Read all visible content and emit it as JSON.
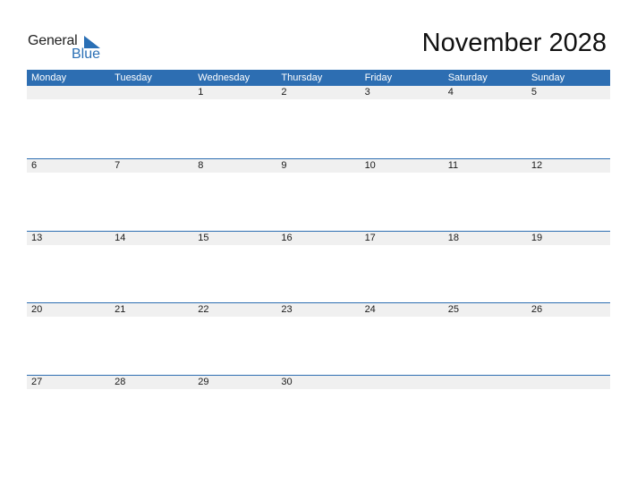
{
  "logo": {
    "line1": "General",
    "line2": "Blue"
  },
  "title": "November 2028",
  "weekdays": [
    "Monday",
    "Tuesday",
    "Wednesday",
    "Thursday",
    "Friday",
    "Saturday",
    "Sunday"
  ],
  "weeks": [
    [
      "",
      "",
      "1",
      "2",
      "3",
      "4",
      "5"
    ],
    [
      "6",
      "7",
      "8",
      "9",
      "10",
      "11",
      "12"
    ],
    [
      "13",
      "14",
      "15",
      "16",
      "17",
      "18",
      "19"
    ],
    [
      "20",
      "21",
      "22",
      "23",
      "24",
      "25",
      "26"
    ],
    [
      "27",
      "28",
      "29",
      "30",
      "",
      "",
      ""
    ]
  ],
  "colors": {
    "header": "#2d6eb2",
    "day_row": "#f0f0f0",
    "brand_blue": "#2a6fb5"
  }
}
